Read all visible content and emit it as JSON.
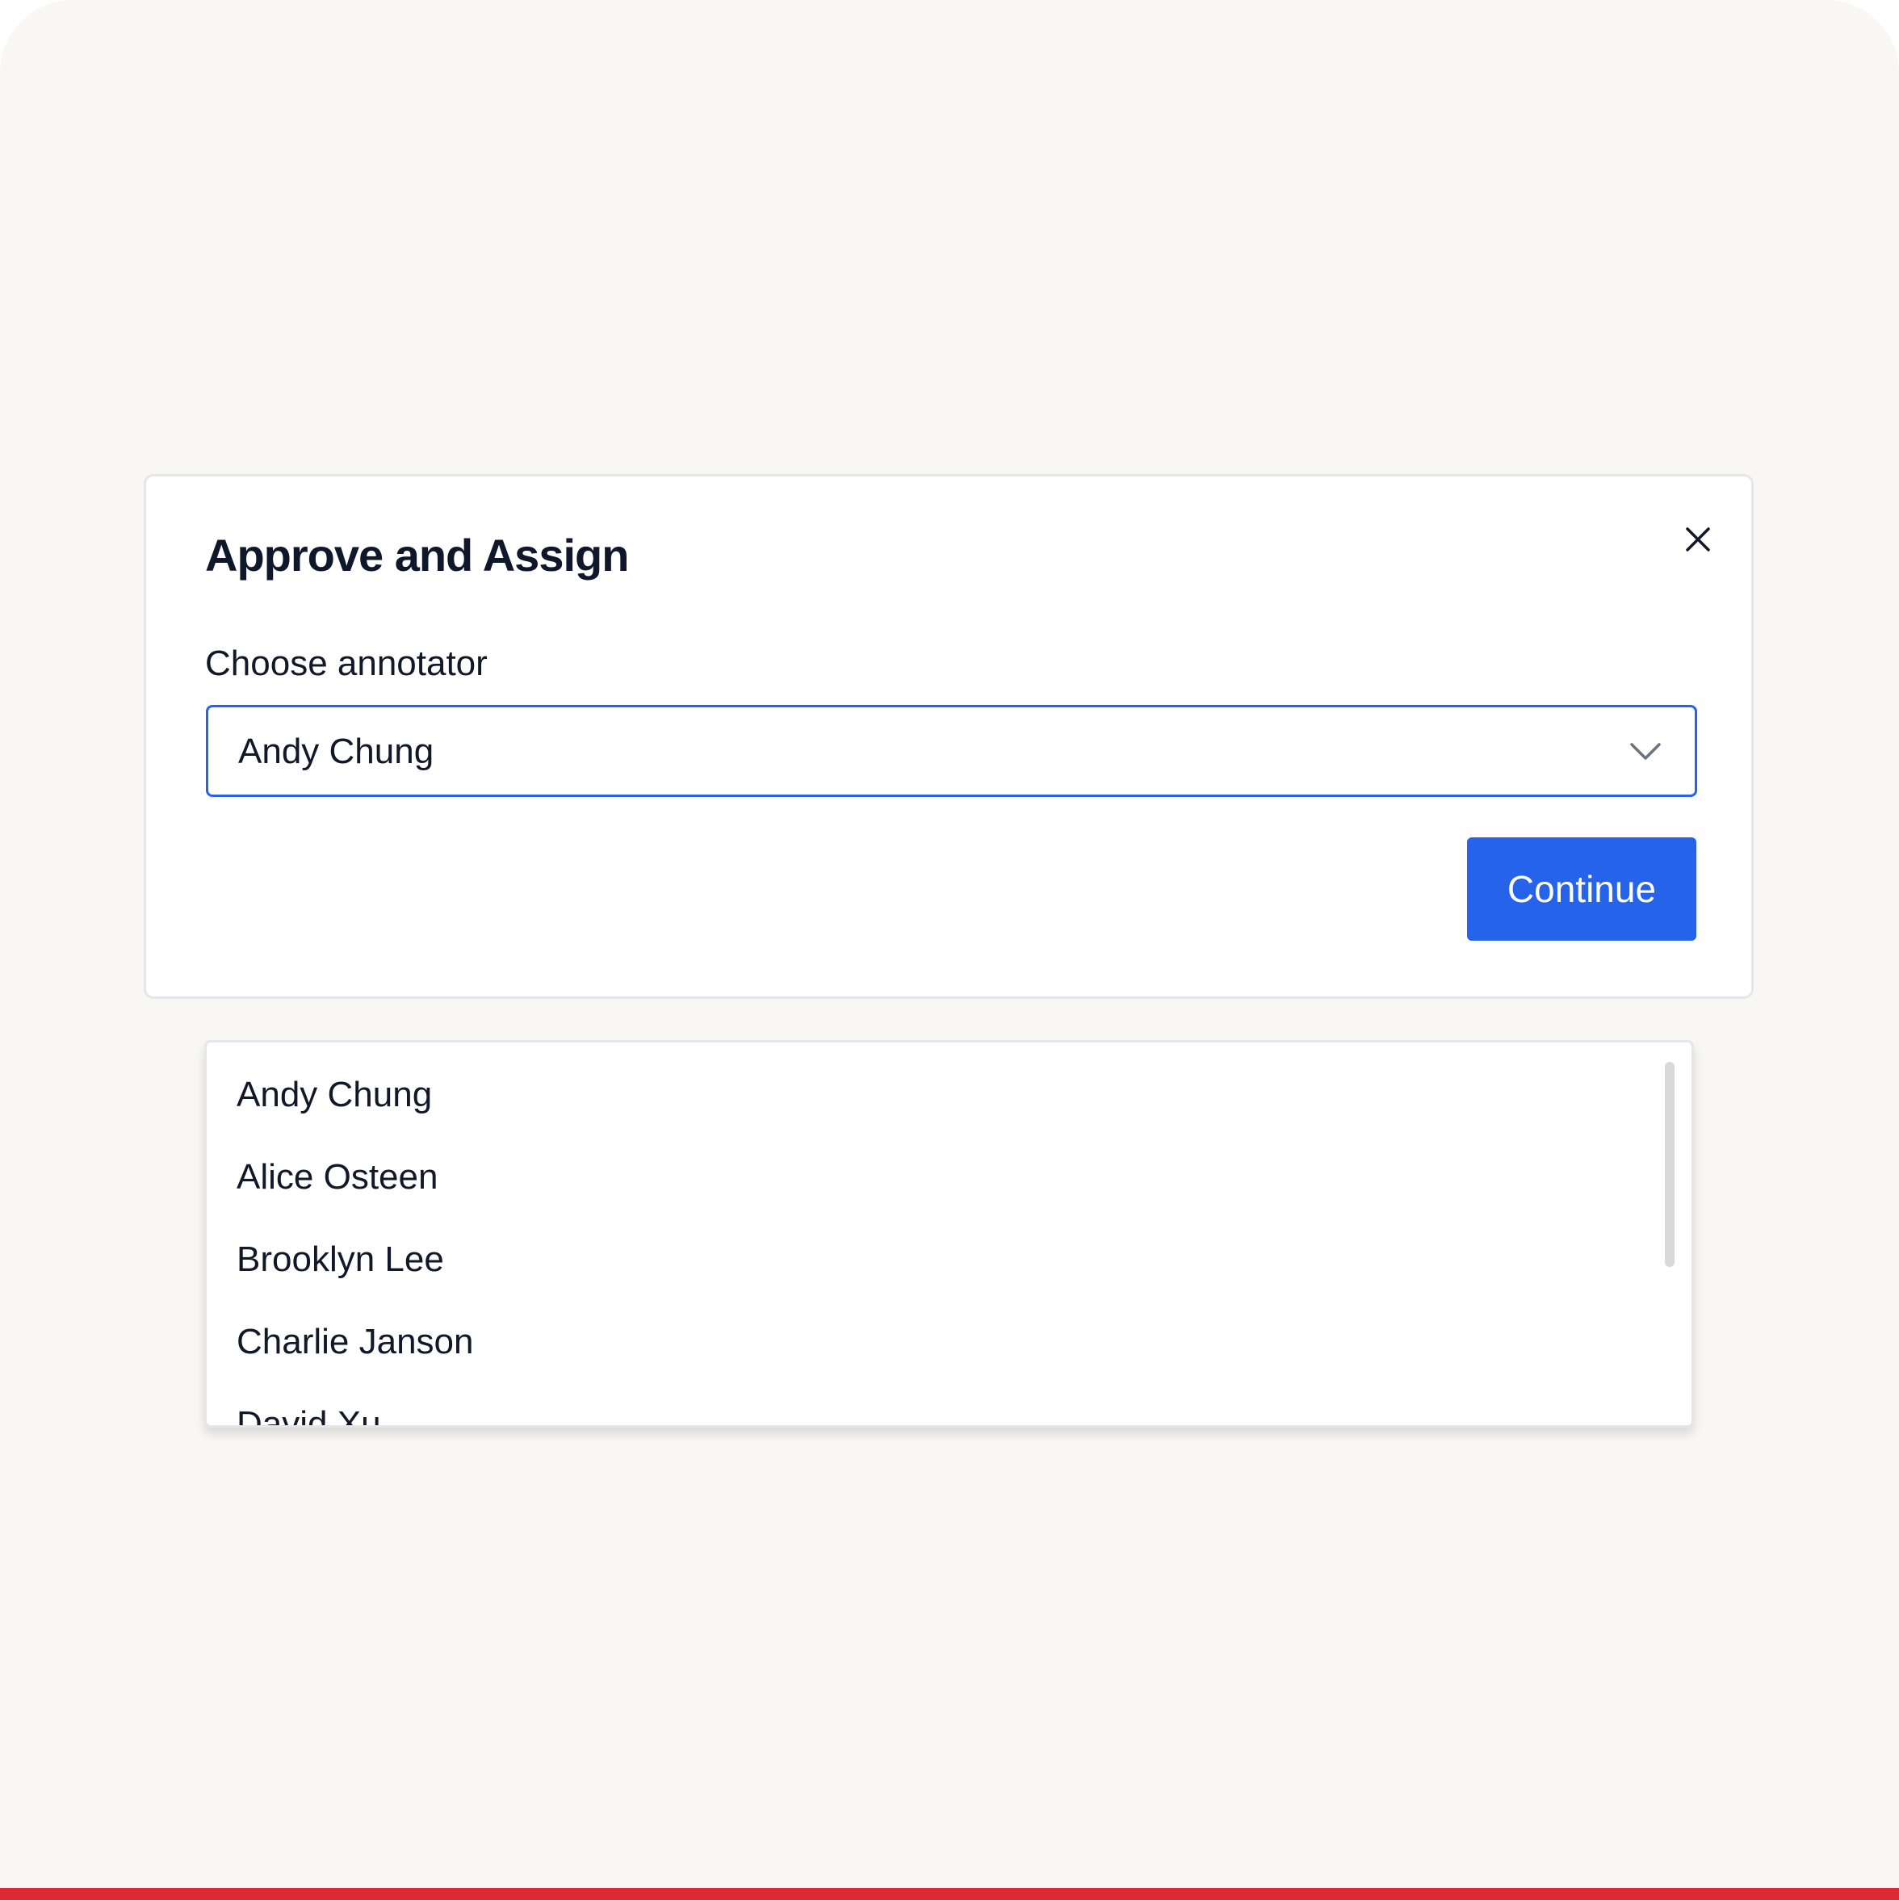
{
  "dialog": {
    "title": "Approve and Assign",
    "close_icon": "close-icon",
    "field_label": "Choose annotator",
    "select": {
      "value": "Andy Chung",
      "icon": "chevron-down-icon"
    },
    "continue_label": "Continue"
  },
  "dropdown": {
    "options": [
      "Andy Chung",
      "Alice Osteen",
      "Brooklyn Lee",
      "Charlie Janson",
      "David Xu"
    ]
  },
  "colors": {
    "accent": "#2563eb",
    "background": "#f8f7f4",
    "bottom_bar": "#dc2a35"
  }
}
